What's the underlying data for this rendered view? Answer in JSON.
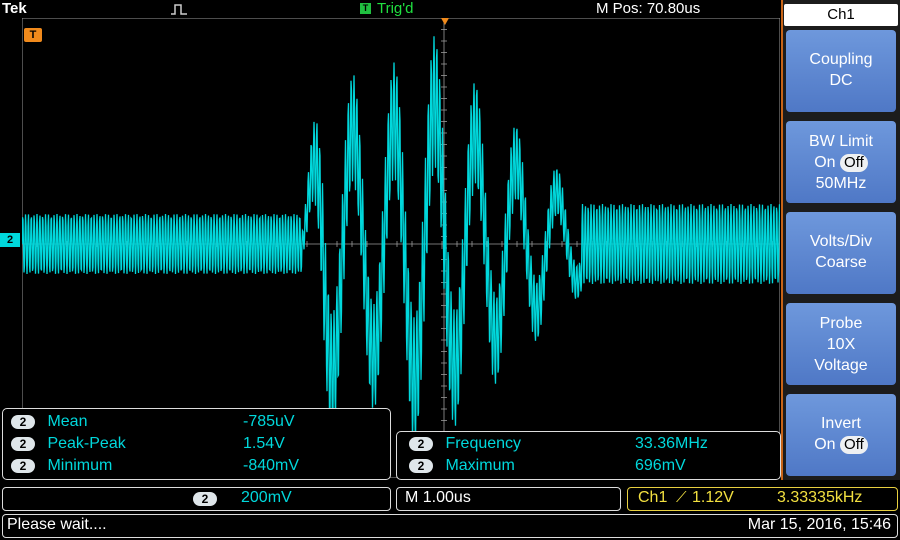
{
  "topbar": {
    "brand": "Tek",
    "trigger_badge": "T",
    "trigger_status": "Trig'd",
    "mpos": "M Pos: 70.80us"
  },
  "markers": {
    "trigger": "T",
    "channel": "2"
  },
  "measurements_left": [
    {
      "ch": "2",
      "label": "Mean",
      "value": "-785uV"
    },
    {
      "ch": "2",
      "label": "Peak-Peak",
      "value": "1.54V"
    },
    {
      "ch": "2",
      "label": "Minimum",
      "value": "-840mV"
    }
  ],
  "measurements_right": [
    {
      "ch": "2",
      "label": "Frequency",
      "value": "33.36MHz"
    },
    {
      "ch": "2",
      "label": "Maximum",
      "value": "696mV"
    }
  ],
  "menu": {
    "title": "Ch1",
    "coupling": {
      "line1": "Coupling",
      "line2": "DC"
    },
    "bw_limit": {
      "line1": "BW Limit",
      "on": "On",
      "off": "Off",
      "line3": "50MHz"
    },
    "volts_div": {
      "line1": "Volts/Div",
      "line2": "Coarse"
    },
    "probe": {
      "line1": "Probe",
      "line2": "10X",
      "line3": "Voltage"
    },
    "invert": {
      "line1": "Invert",
      "on": "On",
      "off": "Off"
    }
  },
  "bottom": {
    "ch_badge": "2",
    "scale": "200mV",
    "timebase": "M 1.00us",
    "trigger_source": "Ch1",
    "trigger_slope": "⟋",
    "trigger_level": "1.12V",
    "trigger_freq": "3.33335kHz"
  },
  "footer": {
    "status": "Please wait....",
    "datetime": "Mar 15, 2016, 15:46"
  },
  "colors": {
    "trace": "#00d8dc",
    "grid": "#9a9a9a",
    "trigger": "#f08a1c",
    "menu": "#5a86d2"
  }
}
